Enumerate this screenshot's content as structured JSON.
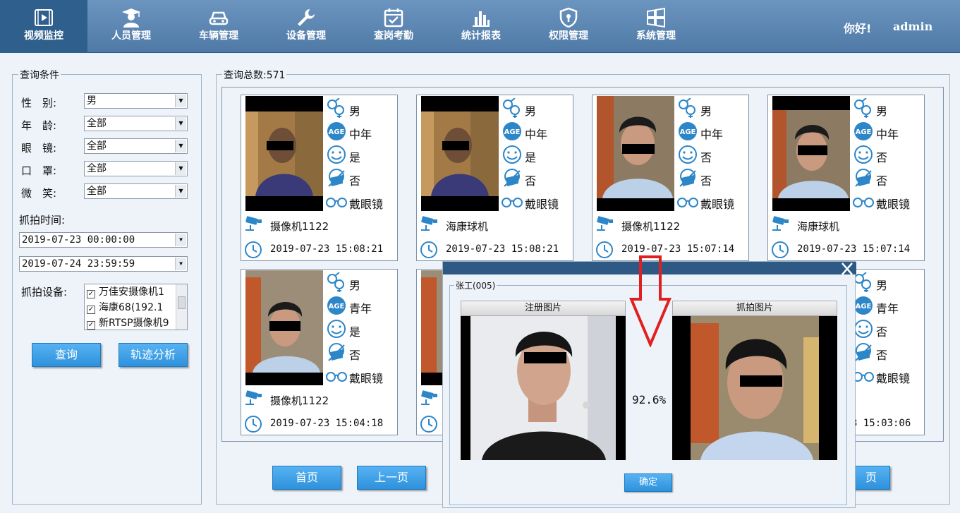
{
  "nav": {
    "items": [
      {
        "label": "视频监控",
        "icon": "video-play-icon",
        "active": true
      },
      {
        "label": "人员管理",
        "icon": "person-graduate-icon",
        "active": false
      },
      {
        "label": "车辆管理",
        "icon": "car-icon",
        "active": false
      },
      {
        "label": "设备管理",
        "icon": "wrench-icon",
        "active": false
      },
      {
        "label": "查岗考勤",
        "icon": "calendar-check-icon",
        "active": false
      },
      {
        "label": "统计报表",
        "icon": "bar-chart-icon",
        "active": false
      },
      {
        "label": "权限管理",
        "icon": "shield-icon",
        "active": false
      },
      {
        "label": "系统管理",
        "icon": "windows-grid-icon",
        "active": false
      }
    ],
    "greeting": "你好!",
    "username": "admin"
  },
  "filter": {
    "title": "查询条件",
    "fields": [
      {
        "label": "性　别:",
        "value": "男"
      },
      {
        "label": "年　龄:",
        "value": "全部"
      },
      {
        "label": "眼　镜:",
        "value": "全部"
      },
      {
        "label": "口　罩:",
        "value": "全部"
      },
      {
        "label": "微　笑:",
        "value": "全部"
      }
    ],
    "time_label": "抓拍时间:",
    "time_start": "2019-07-23 00:00:00",
    "time_end": "2019-07-24 23:59:59",
    "device_label": "抓拍设备:",
    "devices": [
      {
        "label": "万佳安摄像机1",
        "checked": true
      },
      {
        "label": "海康68(192.1",
        "checked": true
      },
      {
        "label": "新RTSP摄像机9",
        "checked": true
      }
    ],
    "query_button": "查询",
    "track_button": "轨迹分析"
  },
  "results": {
    "title": "查询总数:571",
    "cards": [
      {
        "gender": "男",
        "age": "中年",
        "smile": "是",
        "mask": "否",
        "glasses": "戴眼镜",
        "camera": "摄像机1122",
        "time": "2019-07-23 15:08:21"
      },
      {
        "gender": "男",
        "age": "中年",
        "smile": "是",
        "mask": "否",
        "glasses": "戴眼镜",
        "camera": "海康球机",
        "time": "2019-07-23 15:08:21"
      },
      {
        "gender": "男",
        "age": "中年",
        "smile": "否",
        "mask": "否",
        "glasses": "戴眼镜",
        "camera": "摄像机1122",
        "time": "2019-07-23 15:07:14"
      },
      {
        "gender": "男",
        "age": "中年",
        "smile": "否",
        "mask": "否",
        "glasses": "戴眼镜",
        "camera": "海康球机",
        "time": "2019-07-23 15:07:14"
      },
      {
        "gender": "男",
        "age": "青年",
        "smile": "是",
        "mask": "否",
        "glasses": "戴眼镜",
        "camera": "摄像机1122",
        "time": "2019-07-23 15:04:18"
      },
      {
        "gender": "",
        "age": "",
        "smile": "",
        "mask": "",
        "glasses": "",
        "camera": "",
        "time": ""
      },
      {
        "gender": "",
        "age": "",
        "smile": "",
        "mask": "",
        "glasses": "",
        "camera": "",
        "time": ""
      },
      {
        "gender": "男",
        "age": "青年",
        "smile": "否",
        "mask": "否",
        "glasses": "戴眼镜",
        "camera": "",
        "time": "3 15:03:06"
      }
    ],
    "first_page": "首页",
    "prev_page": "上一页",
    "last_page_partial": "页"
  },
  "dialog": {
    "group_label": "张工(005)",
    "registered_label": "注册图片",
    "captured_label": "抓拍图片",
    "similarity": "92.6%",
    "confirm": "确定"
  }
}
